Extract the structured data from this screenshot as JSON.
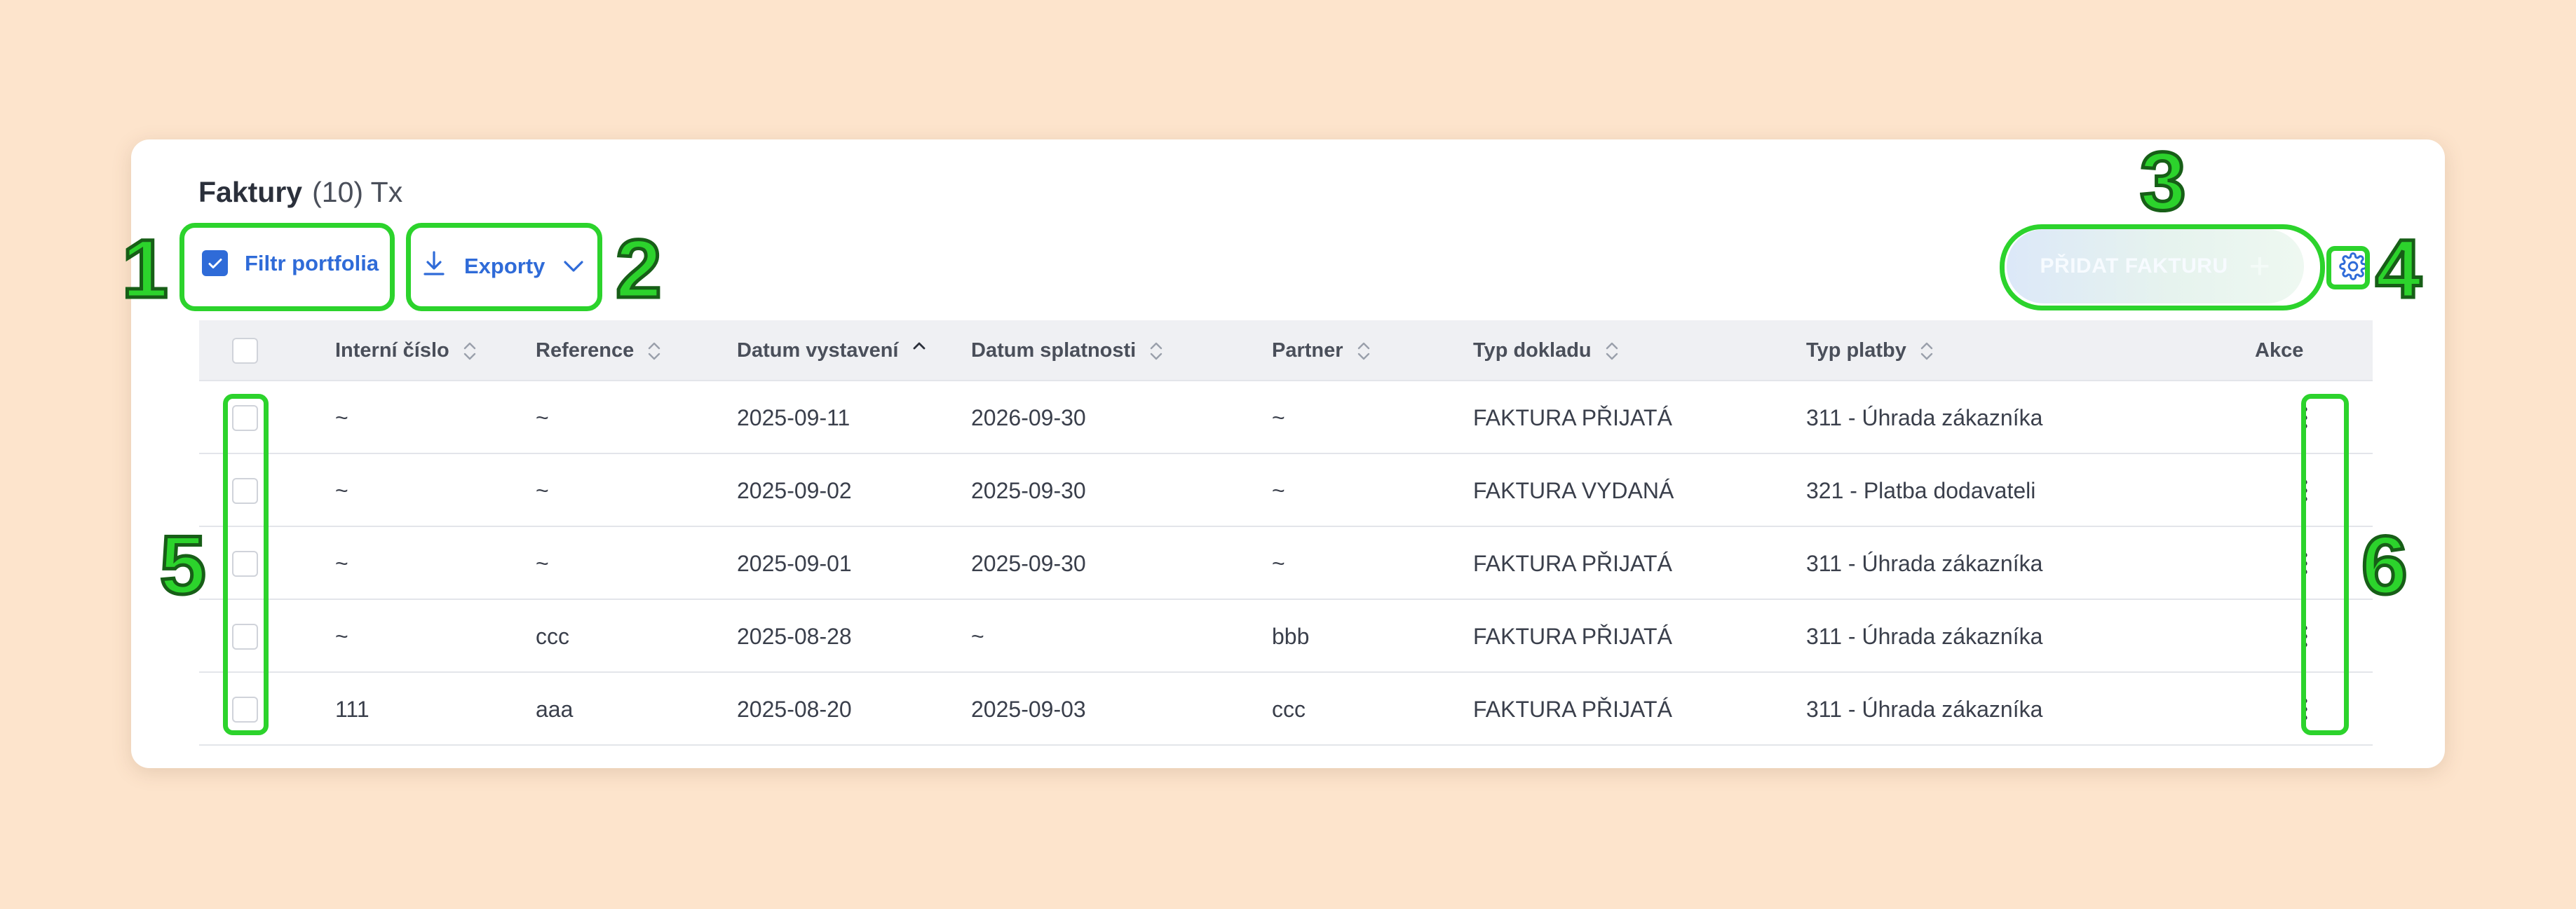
{
  "header": {
    "title": "Faktury",
    "count": "(10) Tx"
  },
  "toolbar": {
    "filter_label": "Filtr portfolia",
    "filter_checked": true,
    "export_label": "Exporty",
    "add_label": "PŘIDAT FAKTURU",
    "add_icon": "plus-icon",
    "settings_icon": "gear-icon"
  },
  "table": {
    "columns": [
      {
        "label": "Interní číslo",
        "sort": "none"
      },
      {
        "label": "Reference",
        "sort": "none"
      },
      {
        "label": "Datum vystavení",
        "sort": "asc"
      },
      {
        "label": "Datum splatnosti",
        "sort": "none"
      },
      {
        "label": "Partner",
        "sort": "none"
      },
      {
        "label": "Typ dokladu",
        "sort": "none"
      },
      {
        "label": "Typ platby",
        "sort": "none"
      },
      {
        "label": "Akce",
        "sort": ""
      }
    ],
    "rows": [
      {
        "internal": "~",
        "reference": "~",
        "issued": "2025-09-11",
        "due": "2026-09-30",
        "partner": "~",
        "doc_type": "FAKTURA PŘIJATÁ",
        "payment": "311 - Úhrada zákazníka"
      },
      {
        "internal": "~",
        "reference": "~",
        "issued": "2025-09-02",
        "due": "2025-09-30",
        "partner": "~",
        "doc_type": "FAKTURA VYDANÁ",
        "payment": "321 - Platba dodavateli"
      },
      {
        "internal": "~",
        "reference": "~",
        "issued": "2025-09-01",
        "due": "2025-09-30",
        "partner": "~",
        "doc_type": "FAKTURA PŘIJATÁ",
        "payment": "311 - Úhrada zákazníka"
      },
      {
        "internal": "~",
        "reference": "ccc",
        "issued": "2025-08-28",
        "due": "~",
        "partner": "bbb",
        "doc_type": "FAKTURA PŘIJATÁ",
        "payment": "311 - Úhrada zákazníka"
      },
      {
        "internal": "111",
        "reference": "aaa",
        "issued": "2025-08-20",
        "due": "2025-09-03",
        "partner": "ccc",
        "doc_type": "FAKTURA PŘIJATÁ",
        "payment": "311 - Úhrada zákazníka"
      }
    ]
  },
  "annotations": {
    "highlight_color": "#2cd32c",
    "labels": [
      "1",
      "2",
      "3",
      "4",
      "5",
      "6"
    ]
  },
  "colors": {
    "accent": "#2f6bd8",
    "background": "#fde4cc"
  }
}
